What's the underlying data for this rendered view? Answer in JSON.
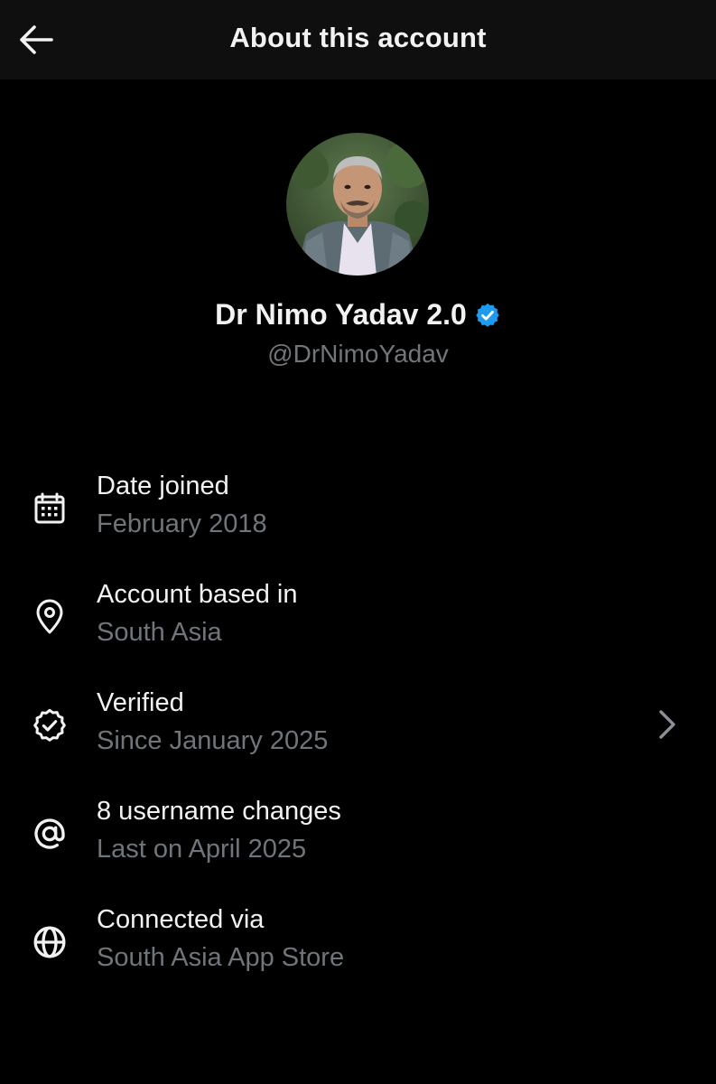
{
  "header": {
    "title": "About this account",
    "back_icon": "arrow-left-icon"
  },
  "profile": {
    "name": "Dr Nimo Yadav 2.0",
    "handle": "@DrNimoYadav",
    "verified_icon": "verified-badge-icon",
    "verified_color": "#1d9bf0"
  },
  "info": {
    "items": [
      {
        "icon": "calendar-icon",
        "title": "Date joined",
        "subtitle": "February 2018"
      },
      {
        "icon": "location-pin-icon",
        "title": "Account based in",
        "subtitle": "South Asia"
      },
      {
        "icon": "verified-check-icon",
        "title": "Verified",
        "subtitle": "Since January 2025",
        "has_chevron": true
      },
      {
        "icon": "at-sign-icon",
        "title": "8 username changes",
        "subtitle": "Last on April 2025"
      },
      {
        "icon": "globe-icon",
        "title": "Connected via",
        "subtitle": "South Asia App Store"
      }
    ]
  },
  "colors": {
    "background": "#000000",
    "header_background": "#0f0f0f",
    "primary_text": "#f2f2f2",
    "secondary_text": "#6f757b",
    "accent": "#1d9bf0"
  }
}
